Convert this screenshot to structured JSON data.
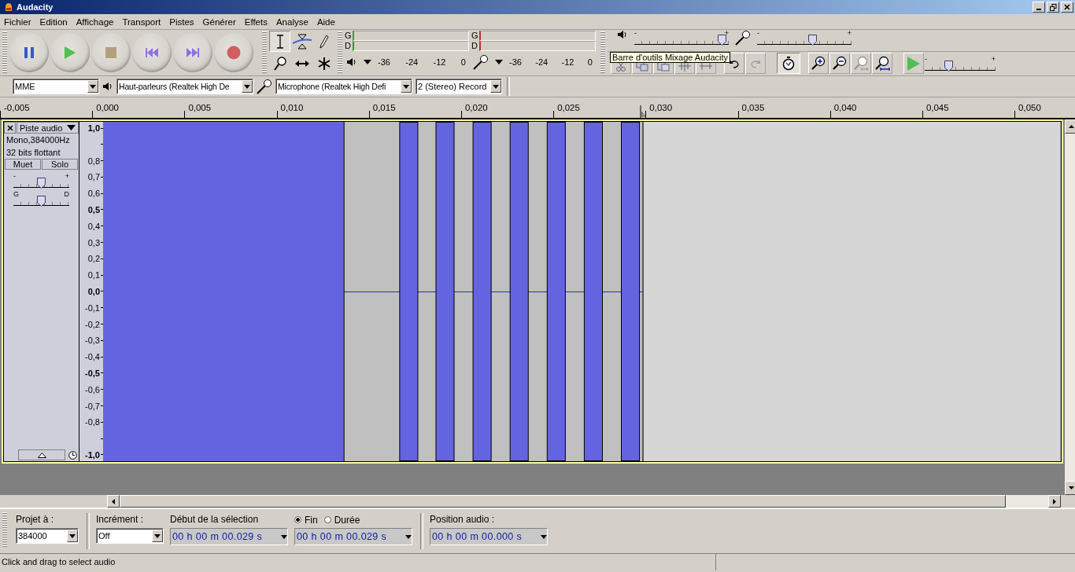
{
  "window": {
    "title": "Audacity"
  },
  "menu": [
    "Fichier",
    "Edition",
    "Affichage",
    "Transport",
    "Pistes",
    "Générer",
    "Effets",
    "Analyse",
    "Aide"
  ],
  "transport": [
    {
      "kind": "pause"
    },
    {
      "kind": "play"
    },
    {
      "kind": "stop"
    },
    {
      "kind": "skip_start"
    },
    {
      "kind": "skip_end"
    },
    {
      "kind": "record"
    }
  ],
  "tools": [
    {
      "kind": "select",
      "selected": true
    },
    {
      "kind": "envelope",
      "selected": false
    },
    {
      "kind": "draw",
      "selected": false
    },
    {
      "kind": "zoom",
      "selected": false
    },
    {
      "kind": "timeshift",
      "selected": false
    },
    {
      "kind": "multi",
      "selected": false
    }
  ],
  "meters": [
    {
      "kind": "playback",
      "channels": [
        "G",
        "D"
      ],
      "ticks": [
        "-36",
        "-24",
        "-12",
        "0"
      ]
    },
    {
      "kind": "record",
      "channels": [
        "G",
        "D"
      ],
      "ticks": [
        "-36",
        "-24",
        "-12",
        "0"
      ]
    }
  ],
  "mixer": {
    "playback": {
      "min": "-",
      "max": "+",
      "level": 0.97
    },
    "record": {
      "min": "-",
      "max": "+",
      "level": 0.6
    }
  },
  "edit_buttons": [
    {
      "kind": "undo",
      "disabled": false
    },
    {
      "kind": "redo",
      "disabled": true
    }
  ],
  "sync_lock": {
    "on": true
  },
  "zoom_buttons": [
    {
      "kind": "zoom_in",
      "disabled": false
    },
    {
      "kind": "zoom_out",
      "disabled": false
    },
    {
      "kind": "fit_selection",
      "disabled": true
    },
    {
      "kind": "zoom_fit",
      "disabled": false
    }
  ],
  "play_at_speed": {
    "min": "-",
    "max": "+",
    "level": 0.32
  },
  "tooltip": "Barre d'outils Mixage Audacity",
  "devices": {
    "host": "MME",
    "output": "Haut-parleurs (Realtek High De",
    "input": "Microphone (Realtek High Defi",
    "channels": "2 (Stereo) Record"
  },
  "ruler": [
    "-0,005",
    "0,000",
    "0,005",
    "0,010",
    "0,015",
    "0,020",
    "0,025",
    "0,030",
    "0,035",
    "0,040",
    "0,045",
    "0,050"
  ],
  "track": {
    "name": "Piste audio",
    "info": [
      "Mono,384000Hz",
      "32 bits flottant"
    ],
    "mute": "Muet",
    "solo": "Solo",
    "gain": {
      "min": "-",
      "max": "+",
      "level": 0.5
    },
    "pan": {
      "min": "G",
      "max": "D",
      "level": 0.5
    },
    "scale": [
      {
        "label": "1,0",
        "major": true
      },
      {
        "label": "0,8",
        "major": false
      },
      {
        "label": "0,7",
        "major": false
      },
      {
        "label": "0,6",
        "major": false
      },
      {
        "label": "0,5",
        "major": true
      },
      {
        "label": "0,4",
        "major": false
      },
      {
        "label": "0,3",
        "major": false
      },
      {
        "label": "0,2",
        "major": false
      },
      {
        "label": "0,1",
        "major": false
      },
      {
        "label": "0,0",
        "major": true
      },
      {
        "label": "-0,1",
        "major": false
      },
      {
        "label": "-0,2",
        "major": false
      },
      {
        "label": "-0,3",
        "major": false
      },
      {
        "label": "-0,4",
        "major": false
      },
      {
        "label": "-0,5",
        "major": true
      },
      {
        "label": "-0,6",
        "major": false
      },
      {
        "label": "-0,7",
        "major": false
      },
      {
        "label": "-0,8",
        "major": false
      },
      {
        "label": "-1,0",
        "major": true
      }
    ]
  },
  "selection_bar": {
    "project_rate": {
      "label": "Projet à :",
      "value": "384000"
    },
    "snap": {
      "label": "Incrément :",
      "value": "Off"
    },
    "start": {
      "label": "Début de la sélection",
      "value": "00 h 00 m 00.029 s"
    },
    "end_modes": [
      {
        "label": "Fin",
        "selected": true
      },
      {
        "label": "Durée",
        "selected": false
      }
    ],
    "end": {
      "value": "00 h 00 m 00.029 s"
    },
    "audio_position": {
      "label": "Position audio :",
      "value": "00 h 00 m 00.000 s"
    }
  },
  "status_bar": {
    "text": "Click and drag to select audio"
  }
}
